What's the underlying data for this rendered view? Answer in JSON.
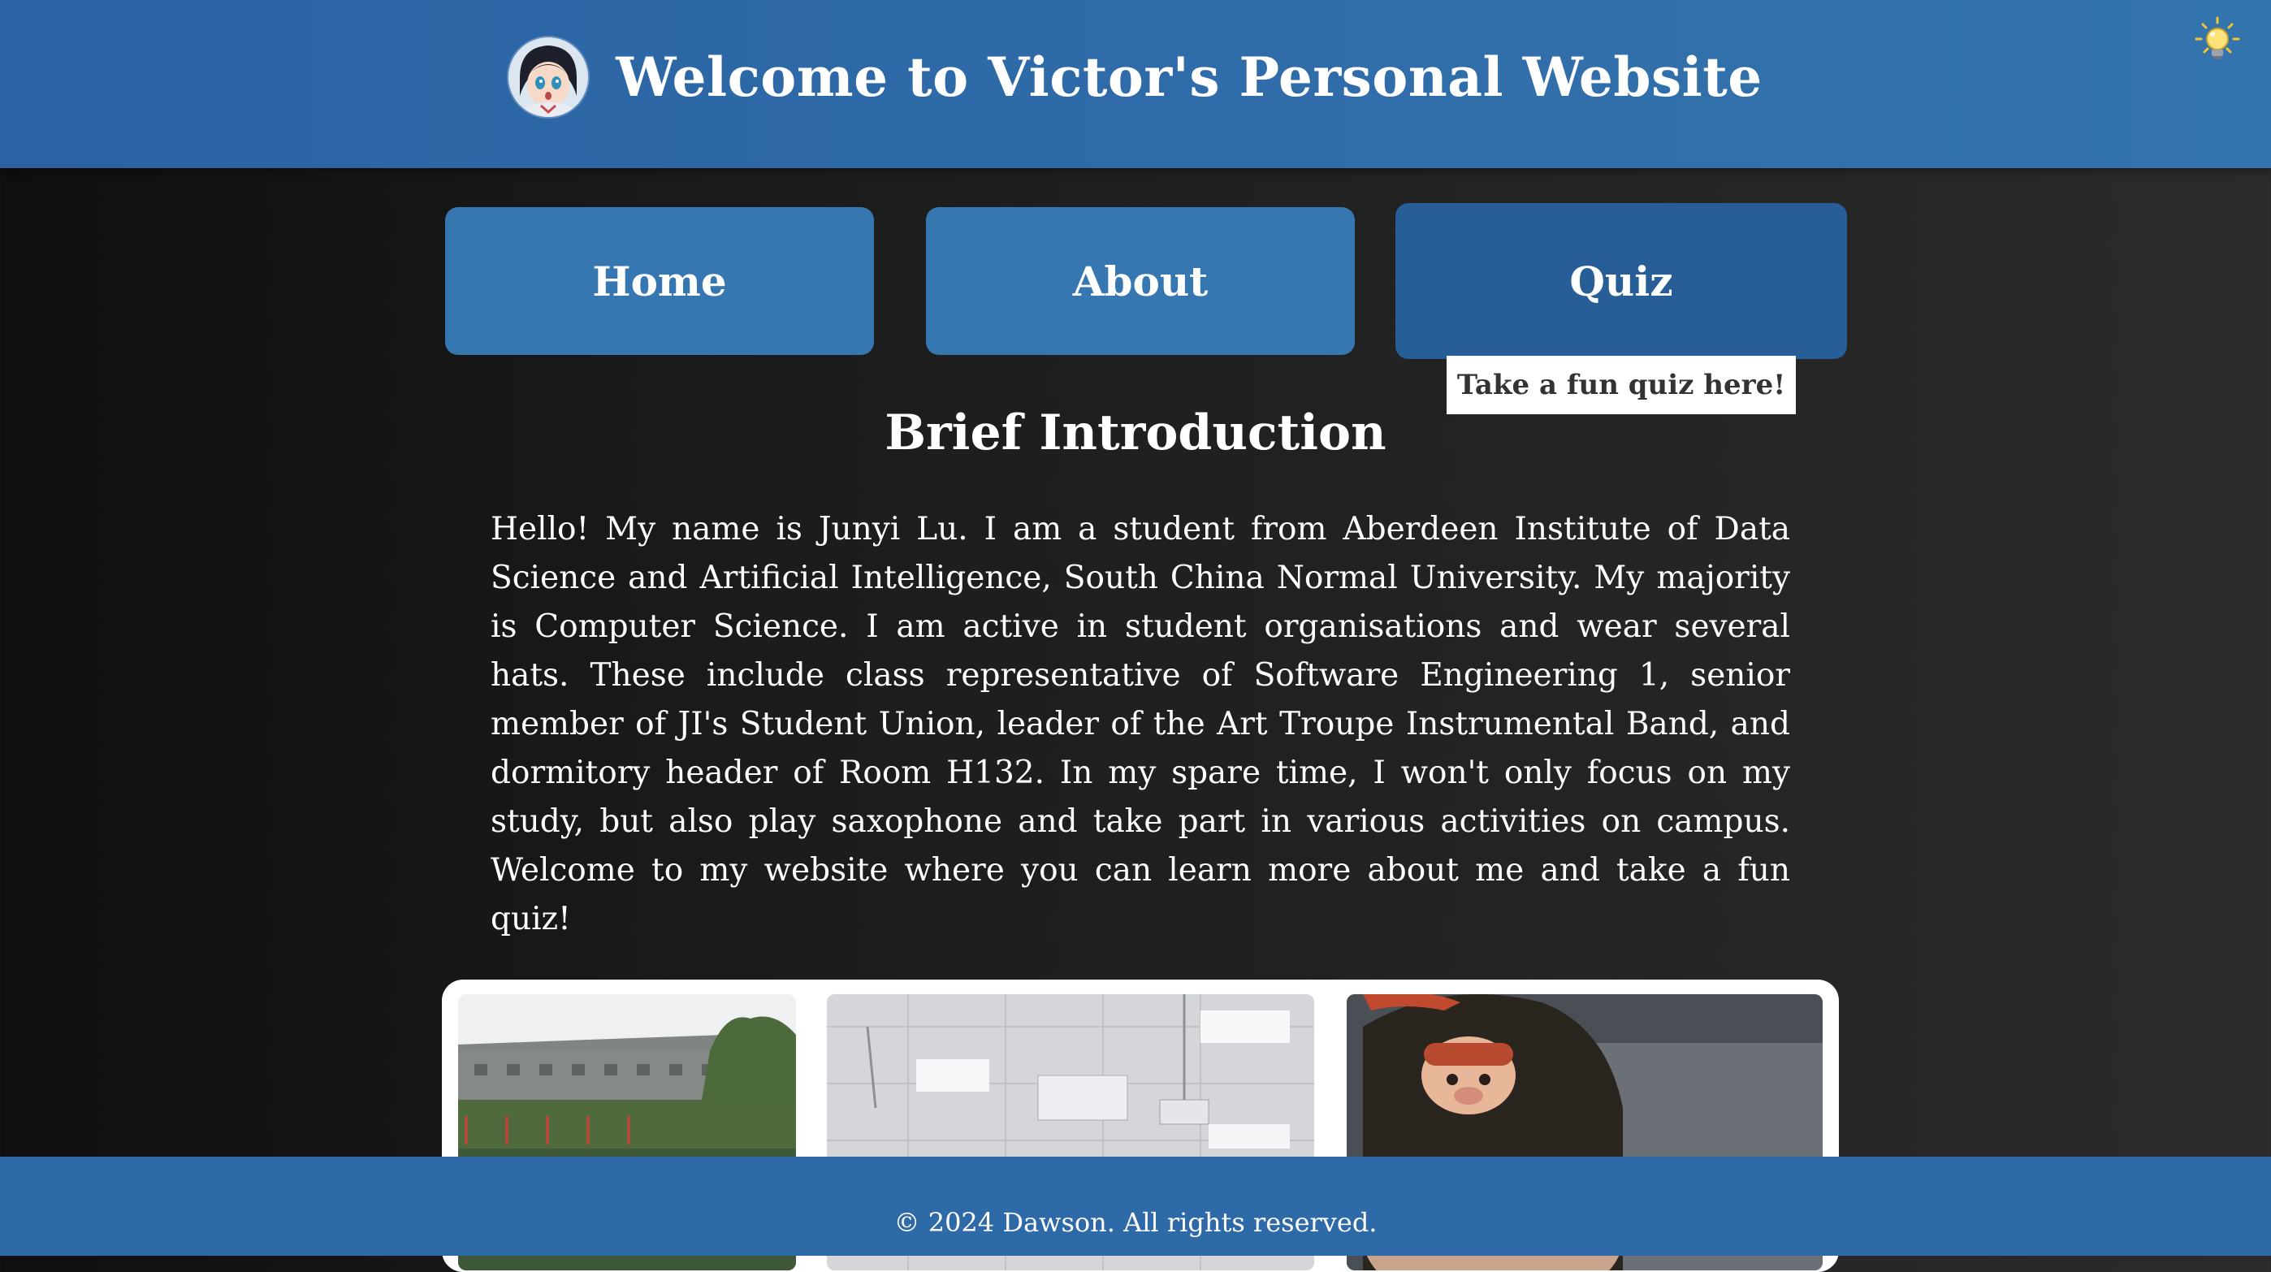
{
  "header": {
    "title": "Welcome to Victor's Personal Website",
    "avatar_icon": "anime-girl-avatar",
    "theme_toggle_icon": "lightbulb-icon"
  },
  "nav": {
    "items": [
      {
        "label": "Home"
      },
      {
        "label": "About"
      },
      {
        "label": "Quiz",
        "state": "hover"
      }
    ],
    "tooltip": "Take a fun quiz here!"
  },
  "intro": {
    "heading": "Brief Introduction",
    "text": "Hello! My name is Junyi Lu. I am a student from Aberdeen Institute of Data Science and Artificial Intelligence, South China Normal University. My majority is Computer Science. I am active in student organisations and wear several hats. These include class representative of Software Engineering 1, senior member of JI's Student Union, leader of the Art Troupe Instrumental Band, and dormitory header of Room H132. In my spare time, I won't only focus on my study, but also play saxophone and take part in various activities on campus. Welcome to my website where you can learn more about me and take a fun quiz!"
  },
  "gallery": {
    "photos": [
      {
        "subject": "building-on-hillside"
      },
      {
        "subject": "classroom-ceiling-with-projector"
      },
      {
        "subject": "person-with-toy-on-head"
      }
    ]
  },
  "footer": {
    "text": "© 2024 Dawson. All rights reserved."
  },
  "colors": {
    "header_bg": "#2f6faa",
    "nav_button": "#3677b2",
    "nav_button_hover": "#275e98",
    "footer_bg": "#2f6aa8"
  }
}
